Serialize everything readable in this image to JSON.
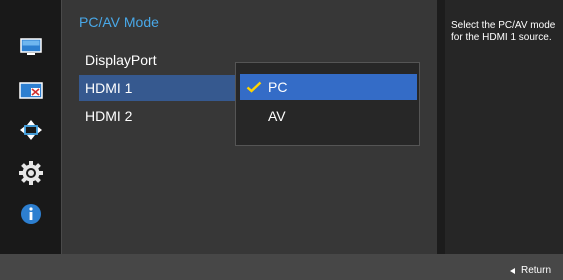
{
  "sidebar": {
    "items": [
      {
        "icon": "picture-icon"
      },
      {
        "icon": "color-icon"
      },
      {
        "icon": "size-position-icon"
      },
      {
        "icon": "system-gear-icon"
      },
      {
        "icon": "information-icon"
      }
    ]
  },
  "main": {
    "title": "PC/AV Mode",
    "items": [
      {
        "label": "DisplayPort"
      },
      {
        "label": "HDMI 1"
      },
      {
        "label": "HDMI 2"
      }
    ]
  },
  "popup": {
    "options": [
      {
        "label": "PC",
        "checked": true
      },
      {
        "label": "AV",
        "checked": false
      }
    ]
  },
  "help": {
    "text": "Select the PC/AV mode\nfor the HDMI 1 source."
  },
  "bottom": {
    "return_label": "Return"
  },
  "colors": {
    "title": "#49a8e8",
    "menu_highlight": "#36598f",
    "option_highlight": "#346cc7",
    "check": "#ffd400"
  }
}
